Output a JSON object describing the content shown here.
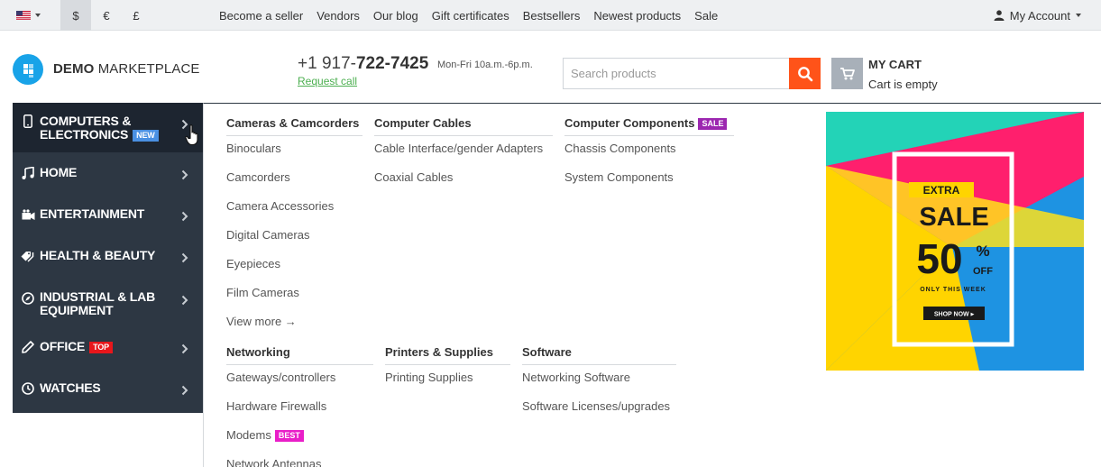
{
  "topbar": {
    "language_flag": "us-flag-icon",
    "currencies": [
      {
        "symbol": "$",
        "active": true
      },
      {
        "symbol": "€",
        "active": false
      },
      {
        "symbol": "£",
        "active": false
      }
    ],
    "links": [
      "Become a seller",
      "Vendors",
      "Our blog",
      "Gift certificates",
      "Bestsellers",
      "Newest products",
      "Sale"
    ],
    "account_label": "My Account"
  },
  "header": {
    "logo_bold": "DEMO",
    "logo_light": "MARKETPLACE",
    "phone_prefix": "+1 917-",
    "phone_main": "722-7425",
    "phone_hours": "Mon-Fri 10a.m.-6p.m.",
    "request_call": "Request call",
    "search_placeholder": "Search products",
    "cart_title": "MY CART",
    "cart_status": "Cart is empty"
  },
  "colors": {
    "accent": "#ff5319",
    "sidebar_bg": "#2d3743",
    "logo_blue": "#18a3e8",
    "badge_new": "#4a90e2",
    "badge_top": "#e8161b",
    "badge_sale": "#9c27b0",
    "badge_best": "#e91ec8"
  },
  "sidebar": {
    "items": [
      {
        "line1": "COMPUTERS &",
        "line2": "ELECTRONICS",
        "badge": "NEW",
        "icon": "phone-icon"
      },
      {
        "line1": "HOME",
        "line2": "",
        "badge": "",
        "icon": "music-note-icon"
      },
      {
        "line1": "ENTERTAINMENT",
        "line2": "",
        "badge": "",
        "icon": "video-camera-icon"
      },
      {
        "line1": "HEALTH & BEAUTY",
        "line2": "",
        "badge": "",
        "icon": "tags-icon"
      },
      {
        "line1": "INDUSTRIAL & LAB",
        "line2": "EQUIPMENT",
        "badge": "",
        "icon": "compass-icon"
      },
      {
        "line1": "OFFICE",
        "line2": "",
        "badge": "TOP",
        "icon": "pencil-icon"
      },
      {
        "line1": "WATCHES",
        "line2": "",
        "badge": "",
        "icon": "clock-icon"
      }
    ]
  },
  "menu": {
    "cameras": {
      "title": "Cameras & Camcorders",
      "links": [
        "Binoculars",
        "Camcorders",
        "Camera Accessories",
        "Digital Cameras",
        "Eyepieces",
        "Film Cameras",
        "View more →"
      ]
    },
    "cables": {
      "title": "Computer Cables",
      "links": [
        "Cable Interface/gender Adapters",
        "Coaxial Cables"
      ]
    },
    "components": {
      "title": "Computer Components",
      "badge": "SALE",
      "links": [
        "Chassis Components",
        "System Components"
      ]
    },
    "networking": {
      "title": "Networking",
      "links": [
        "Gateways/controllers",
        "Hardware Firewalls",
        "Modems",
        "Network Antennas"
      ],
      "modems_badge": "BEST"
    },
    "printers": {
      "title": "Printers & Supplies",
      "links": [
        "Printing Supplies"
      ]
    },
    "software": {
      "title": "Software",
      "links": [
        "Networking Software",
        "Software Licenses/upgrades"
      ]
    }
  },
  "banner": {
    "extra": "EXTRA",
    "sale": "SALE",
    "percent": "50",
    "percent_sign": "%",
    "off": "OFF",
    "only": "ONLY THIS WEEK",
    "shop": "SHOP NOW ▸"
  }
}
